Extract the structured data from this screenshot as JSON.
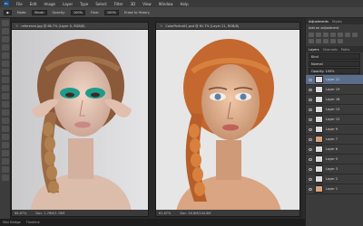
{
  "app": {
    "logo": "Ps",
    "menu": [
      "File",
      "Edit",
      "Image",
      "Layer",
      "Type",
      "Select",
      "Filter",
      "3D",
      "View",
      "Window",
      "Help"
    ]
  },
  "options": {
    "mode_label": "Mode:",
    "mode_value": "Brush",
    "opacity_label": "Opacity:",
    "opacity_value": "100%",
    "flow_label": "Flow:",
    "flow_value": "100%",
    "erase_history": "Erase to History"
  },
  "docs": [
    {
      "title": "reference.jpg @ 66.7% (Layer 0, RGB/8)",
      "zoom": "66.67%",
      "info": "Doc: 1.76M/1.76M"
    },
    {
      "title": "ColorPortrait1.psd @ 61.7% (Layer 21, RGB/8)",
      "zoom": "61.67%",
      "info": "Doc: 26.8M/240.8M"
    }
  ],
  "panel": {
    "tabs_top": [
      "Adjustments",
      "Styles"
    ],
    "adj_label": "Add an adjustment",
    "tabs_layers": [
      "Layers",
      "Channels",
      "Paths"
    ],
    "kind_label": "Kind",
    "blend_mode": "Normal",
    "opacity": "Opacity: 100%",
    "fill": "Fill: 100%",
    "layers": [
      {
        "name": "Layer 21",
        "selected": true,
        "thumb": "white"
      },
      {
        "name": "Layer 19",
        "selected": false,
        "thumb": "white"
      },
      {
        "name": "Layer 18",
        "selected": false,
        "thumb": "white"
      },
      {
        "name": "Layer 13",
        "selected": false,
        "thumb": "white"
      },
      {
        "name": "Layer 12",
        "selected": false,
        "thumb": "white"
      },
      {
        "name": "Layer 9",
        "selected": false,
        "thumb": "white"
      },
      {
        "name": "Layer 7",
        "selected": false,
        "thumb": "skin"
      },
      {
        "name": "Layer 6",
        "selected": false,
        "thumb": "white"
      },
      {
        "name": "Layer 5",
        "selected": false,
        "thumb": "white"
      },
      {
        "name": "Layer 3",
        "selected": false,
        "thumb": "white"
      },
      {
        "name": "Layer 2",
        "selected": false,
        "thumb": "white"
      },
      {
        "name": "Layer 1",
        "selected": false,
        "thumb": "skin"
      }
    ]
  },
  "taskbar": [
    "Mini Bridge",
    "Timeline"
  ]
}
